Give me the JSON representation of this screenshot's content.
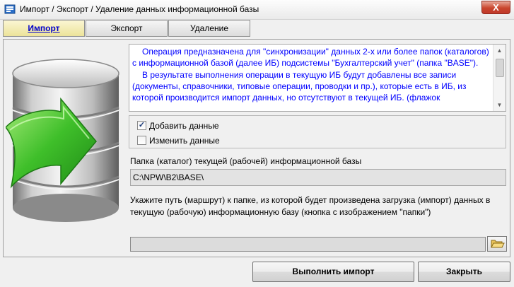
{
  "window": {
    "title": "Импорт / Экспорт / Удаление данных информационной базы",
    "close_label": "X"
  },
  "tabs": [
    {
      "label": "Импорт",
      "active": true
    },
    {
      "label": "Экспорт",
      "active": false
    },
    {
      "label": "Удаление",
      "active": false
    }
  ],
  "description": {
    "paragraph1": "Операция предназначена для \"синхронизации\" данных 2-х или более папок (каталогов) с информационной базой (далее ИБ) подсистемы \"Бухгалтерский учет\" (папка \"BASE\").",
    "paragraph2": "В результате выполнения операции в текущую ИБ будут добавлены все записи (документы, справочники, типовые операции, проводки и пр.), которые есть в ИБ, из которой производится импорт данных, но отсутствуют в текущей ИБ. (флажок"
  },
  "options": {
    "add_data": {
      "label": "Добавить данные",
      "checked": true
    },
    "change_data": {
      "label": "Изменить данные",
      "checked": false
    }
  },
  "current_folder": {
    "label": "Папка (каталог) текущей (рабочей) информационной базы",
    "value": "C:\\NPW\\B2\\BASE\\"
  },
  "source_folder": {
    "hint": "Укажите путь (маршрут) к папке, из которой будет произведена загрузка (импорт) данных в текущую (рабочую) информационную базу (кнопка с изображением \"папки\")",
    "value": ""
  },
  "buttons": {
    "run_import": "Выполнить импорт",
    "close": "Закрыть"
  },
  "icons": {
    "app": "app-icon",
    "database": "database-icon",
    "arrow": "green-arrow-icon",
    "folder": "open-folder-icon"
  },
  "colors": {
    "description_text": "#0000ff",
    "active_tab": "#ece39a",
    "active_tab_text": "#0000cc",
    "close_button": "#c9462d",
    "arrow_green": "#3fbf2a"
  }
}
